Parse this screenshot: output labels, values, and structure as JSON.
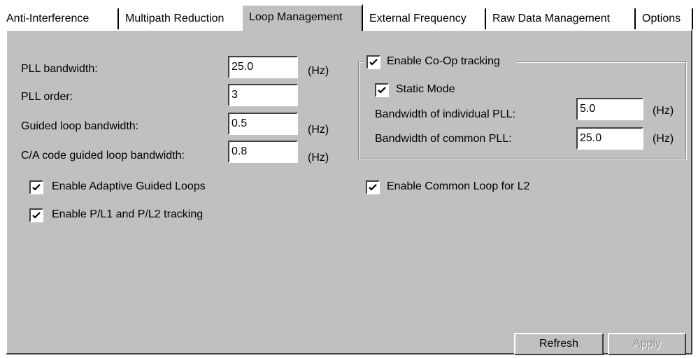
{
  "tabs": [
    "Anti-Interference",
    "Multipath Reduction",
    "Loop Management",
    "External Frequency",
    "Raw Data Management",
    "Options"
  ],
  "active_tab": "Loop Management",
  "fields": {
    "pll_bandwidth": {
      "label": "PLL bandwidth:",
      "value": "25.0",
      "unit": "(Hz)"
    },
    "pll_order": {
      "label": "PLL order:",
      "value": "3"
    },
    "guided_bandwidth": {
      "label": "Guided loop bandwidth:",
      "value": "0.5",
      "unit": "(Hz)"
    },
    "ca_guided_bandwidth": {
      "label": "C/A code guided loop bandwidth:",
      "value": "0.8",
      "unit": "(Hz)"
    }
  },
  "checkboxes": {
    "adaptive_guided": {
      "label": "Enable Adaptive Guided Loops",
      "checked": true
    },
    "p_tracking": {
      "label": "Enable P/L1 and P/L2 tracking",
      "checked": true
    },
    "common_loop_l2": {
      "label": "Enable Common Loop for L2",
      "checked": true
    }
  },
  "coop": {
    "label": "Enable Co-Op tracking",
    "checked": true,
    "static_mode": {
      "label": "Static Mode",
      "checked": true
    },
    "individual": {
      "label": "Bandwidth of individual PLL:",
      "value": "5.0",
      "unit": "(Hz)"
    },
    "common": {
      "label": "Bandwidth of common PLL:",
      "value": "25.0",
      "unit": "(Hz)"
    }
  },
  "buttons": {
    "refresh": "Refresh",
    "apply": "Apply"
  }
}
